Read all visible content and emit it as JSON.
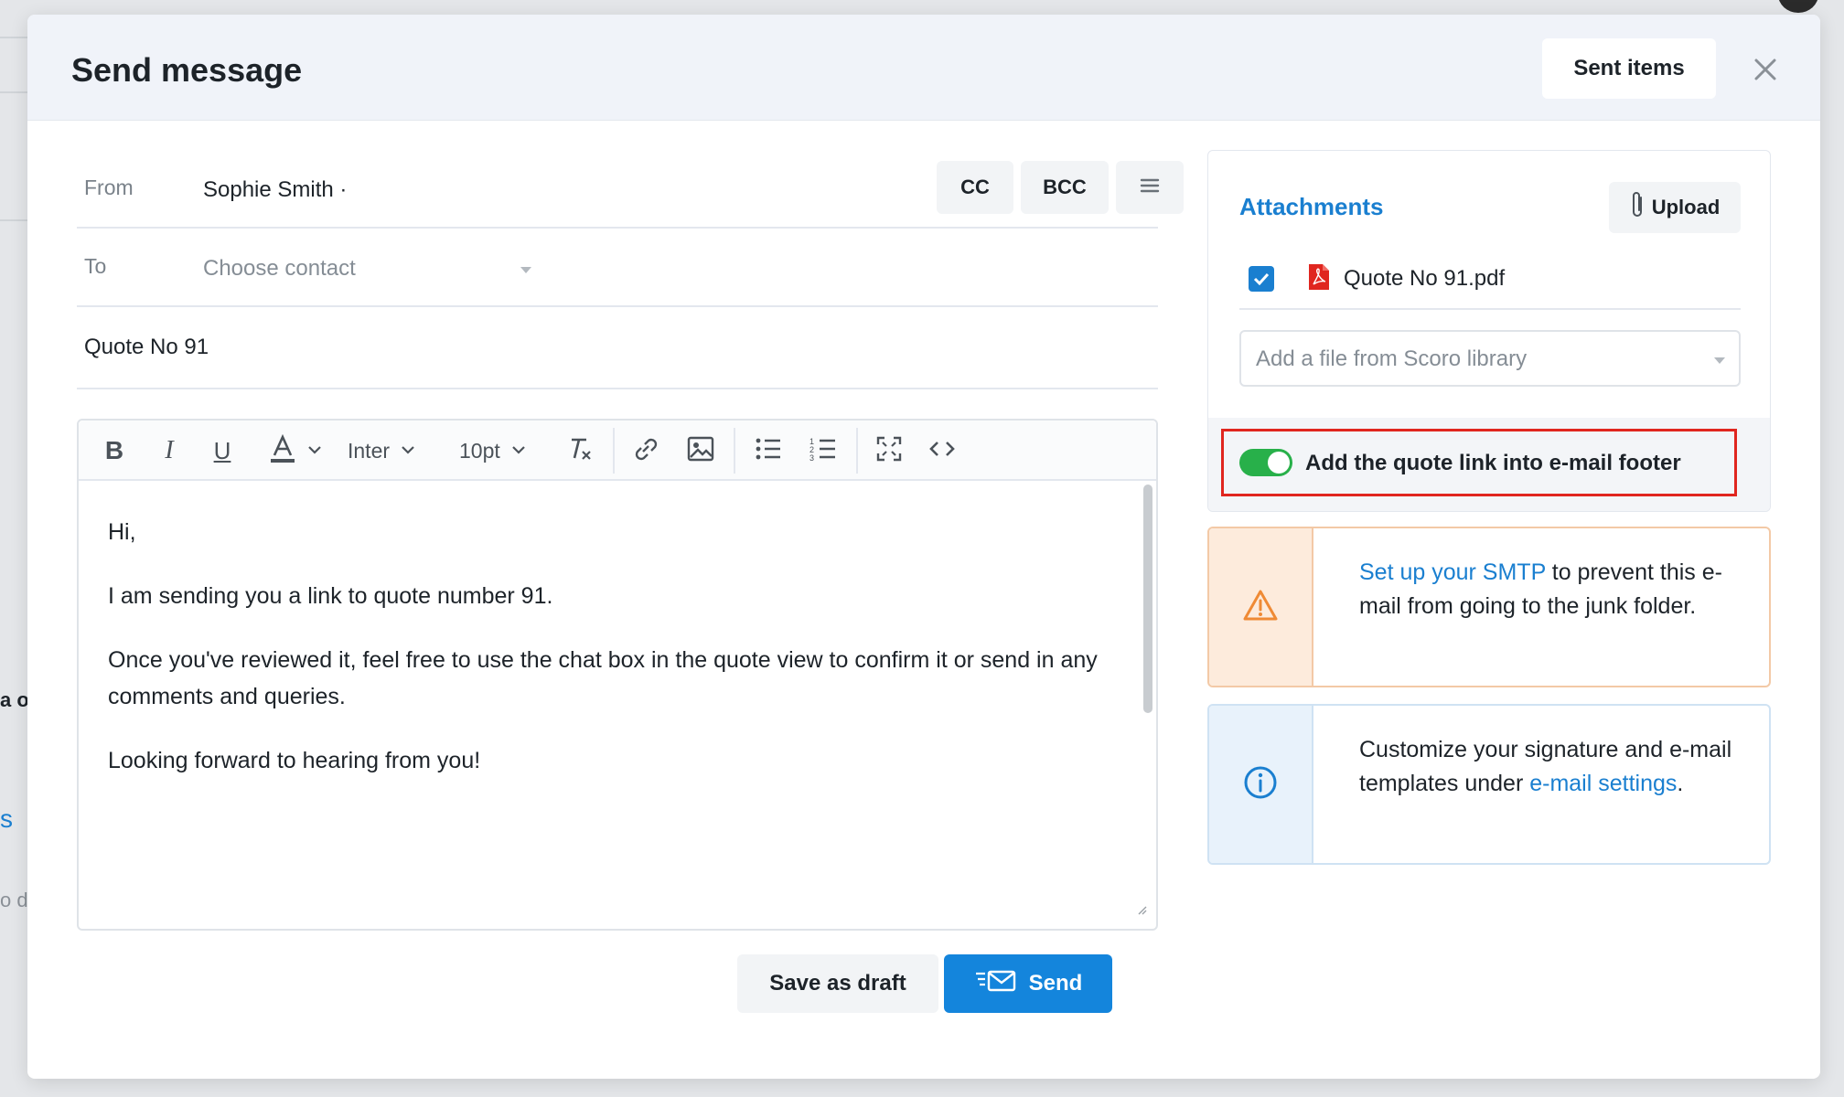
{
  "background": {
    "fragment_a": "a o",
    "fragment_s": "s",
    "fragment_di": "o di"
  },
  "modal": {
    "title": "Send message",
    "sent_items_label": "Sent items"
  },
  "compose": {
    "from_label": "From",
    "from_value": "Sophie Smith ·",
    "cc_label": "CC",
    "bcc_label": "BCC",
    "to_label": "To",
    "to_placeholder": "Choose contact",
    "subject": "Quote No 91"
  },
  "toolbar": {
    "font_family": "Inter",
    "font_size": "10pt"
  },
  "body": {
    "greeting": "Hi,",
    "line1": "I am sending you a link to quote number 91.",
    "line2": "Once you've reviewed it, feel free to use the chat box in the quote view to confirm it or send in any comments and queries.",
    "line3": "Looking forward to hearing from you!"
  },
  "actions": {
    "save_draft_label": "Save as draft",
    "send_label": "Send"
  },
  "attachments": {
    "title": "Attachments",
    "upload_label": "Upload",
    "file_name": "Quote No 91.pdf",
    "file_checked": true,
    "library_placeholder": "Add a file from Scoro library",
    "toggle_label": "Add the quote link into e-mail footer",
    "toggle_on": true
  },
  "smtp_notice": {
    "link_text": "Set up your SMTP",
    "text": " to prevent this e-mail from going to the junk folder."
  },
  "signature_notice": {
    "text": "Customize your signature and e-mail templates under ",
    "link_text": "e-mail settings",
    "suffix": "."
  },
  "colors": {
    "accent": "#1485dc",
    "toggle_on": "#28b04a",
    "highlight": "#e0261f",
    "warning_bg": "#fdebdc",
    "info_bg": "#e8f2fb"
  }
}
